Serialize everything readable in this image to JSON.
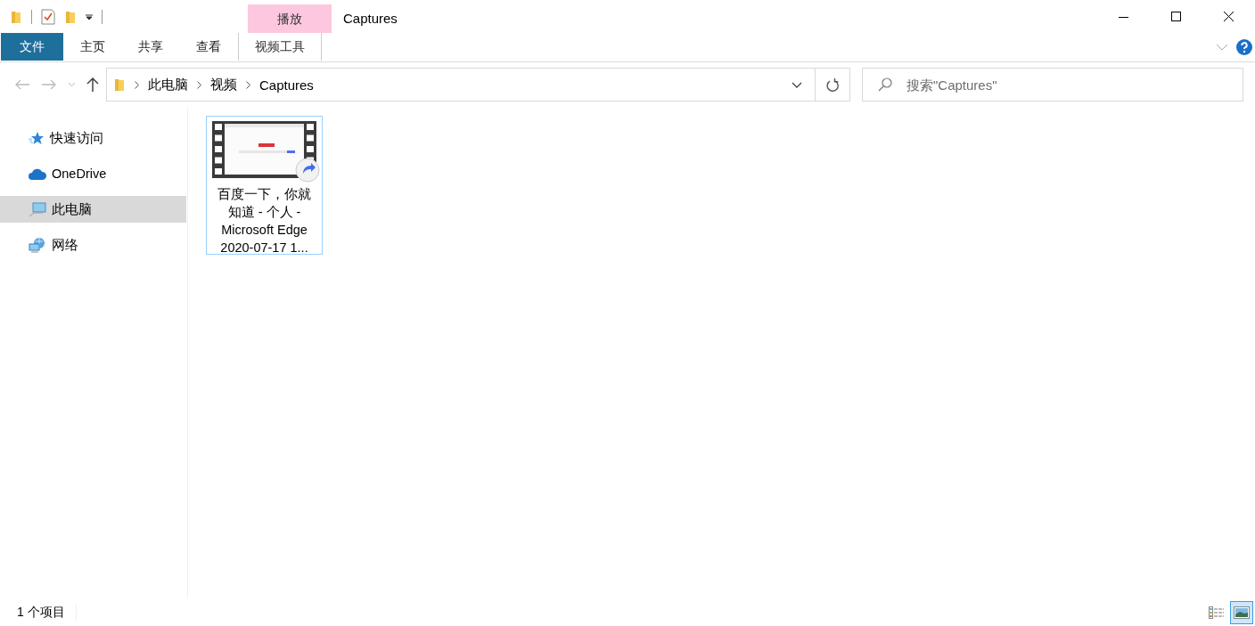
{
  "window": {
    "title": "Captures"
  },
  "contextual_group": {
    "label": "播放"
  },
  "ribbon_tabs": [
    {
      "label": "文件",
      "kind": "file"
    },
    {
      "label": "主页",
      "kind": "tab"
    },
    {
      "label": "共享",
      "kind": "tab"
    },
    {
      "label": "查看",
      "kind": "tab"
    },
    {
      "label": "视频工具",
      "kind": "contextual"
    }
  ],
  "address": {
    "breadcrumbs": [
      "此电脑",
      "视频",
      "Captures"
    ]
  },
  "search": {
    "placeholder": "搜索\"Captures\""
  },
  "sidebar": {
    "items": [
      {
        "label": "快速访问",
        "kind": "star",
        "selected": false
      },
      {
        "label": "OneDrive",
        "kind": "cloud",
        "selected": false
      },
      {
        "label": "此电脑",
        "kind": "pc",
        "selected": true
      },
      {
        "label": "网络",
        "kind": "network",
        "selected": false
      }
    ]
  },
  "files": [
    {
      "name_lines": [
        "百度一下，你就",
        "知道 - 个人 -",
        "Microsoft Edge",
        "2020-07-17 1..."
      ],
      "selected": true
    }
  ],
  "status_bar": {
    "item_count": "1 个项目"
  },
  "view_buttons": [
    {
      "kind": "details",
      "selected": false
    },
    {
      "kind": "large-icons",
      "selected": true
    }
  ]
}
